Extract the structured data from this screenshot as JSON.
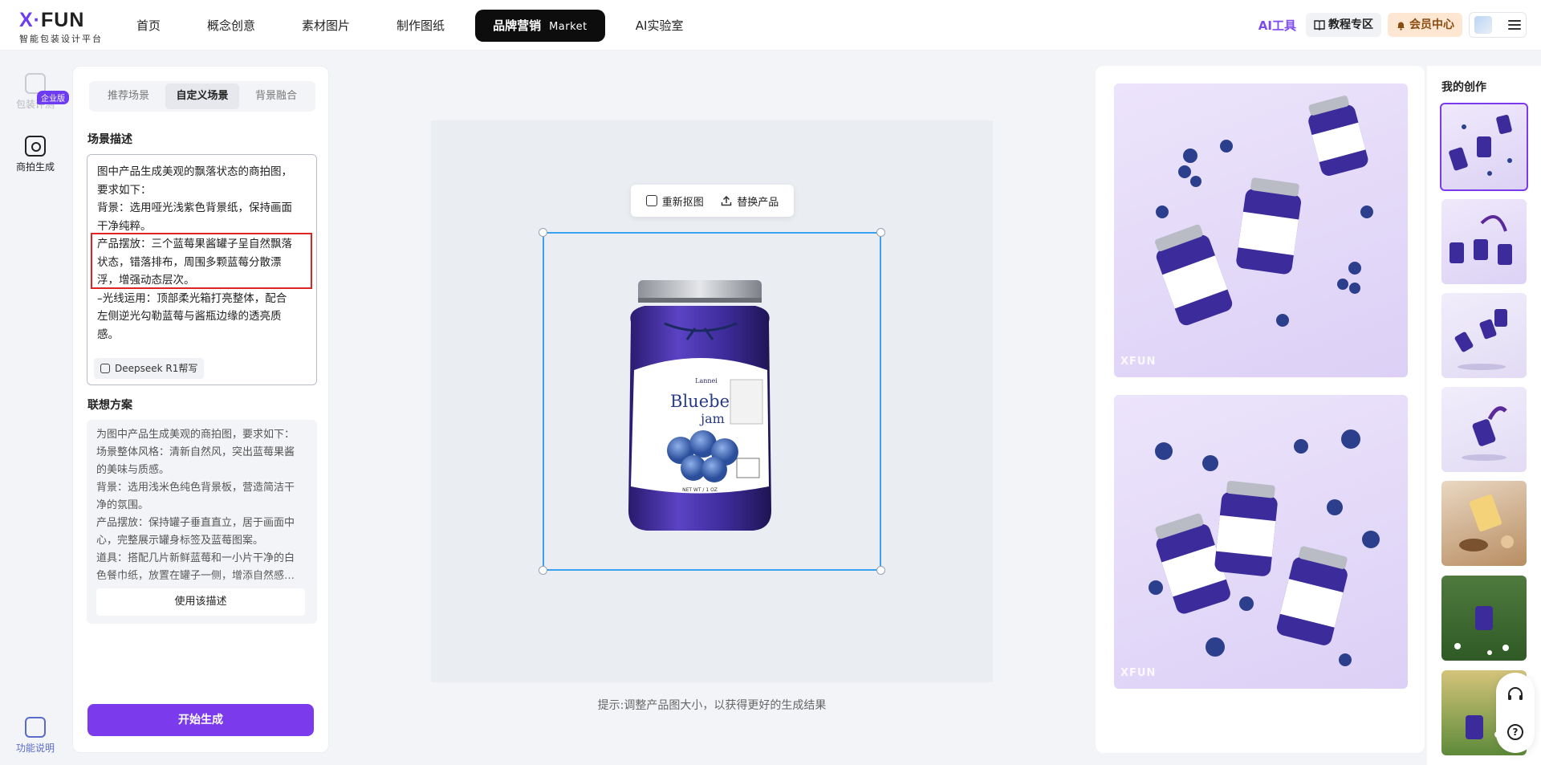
{
  "brand": {
    "name_x": "X·",
    "name_rest": "FUN",
    "tagline": "智能包装设计平台"
  },
  "nav": {
    "items": [
      {
        "label": "首页"
      },
      {
        "label": "概念创意"
      },
      {
        "label": "素材图片"
      },
      {
        "label": "制作图纸"
      }
    ],
    "active_label": "品牌营销",
    "active_tag": "Market",
    "lab_label": "AI实验室",
    "ai_tool": "AI工具",
    "tutorial": "教程专区",
    "vip": "会员中心"
  },
  "rail": {
    "package_review": "包装评测",
    "enterprise_badge": "企业版",
    "product_shoot": "商拍生成",
    "help": "功能说明"
  },
  "panel": {
    "tabs": [
      "推荐场景",
      "自定义场景",
      "背景融合"
    ],
    "active_tab": "自定义场景",
    "scene_title": "场景描述",
    "scene_lines": [
      "图中产品生成美观的飘落状态的商拍图，",
      "要求如下：",
      "背景：选用哑光浅紫色背景纸，保持画面",
      "干净纯粹。",
      "产品摆放：三个蓝莓果酱罐子呈自然飘落",
      "状态，错落排布，周围多颗蓝莓分散漂",
      "浮，增强动态层次。",
      "–光线运用：顶部柔光箱打亮整体，配合",
      "左侧逆光勾勒蓝莓与酱瓶边缘的透亮质",
      "感。"
    ],
    "deepseek_label": "Deepseek R1帮写",
    "assoc_title": "联想方案",
    "assoc_lines": [
      "为图中产品生成美观的商拍图，要求如下：",
      "场景整体风格：清新自然风，突出蓝莓果酱",
      "的美味与质感。",
      "背景：选用浅米色纯色背景板，营造简洁干",
      "净的氛围。",
      "产品摆放：保持罐子垂直直立，居于画面中",
      "心，完整展示罐身标签及蓝莓图案。",
      "道具：搭配几片新鲜蓝莓和一小片干净的白",
      "色餐巾纸，放置在罐子一侧，增添自然感…"
    ],
    "use_label": "使用该描述",
    "generate_label": "开始生成"
  },
  "canvas": {
    "recut_label": "重新抠图",
    "replace_label": "替换产品",
    "jar_brand": "Lannei",
    "jar_title": "Blueberry",
    "jar_sub": "jam",
    "jar_net": "NET WT / 1 OZ",
    "hint": "提示:调整产品图大小，以获得更好的生成结果"
  },
  "results": {
    "watermark": "XFUN"
  },
  "history": {
    "title": "我的创作"
  },
  "colors": {
    "accent": "#7c3aed",
    "selection": "#3aa0f0",
    "highlight": "#e02424",
    "bg_lavender": "#dcd0f6"
  }
}
